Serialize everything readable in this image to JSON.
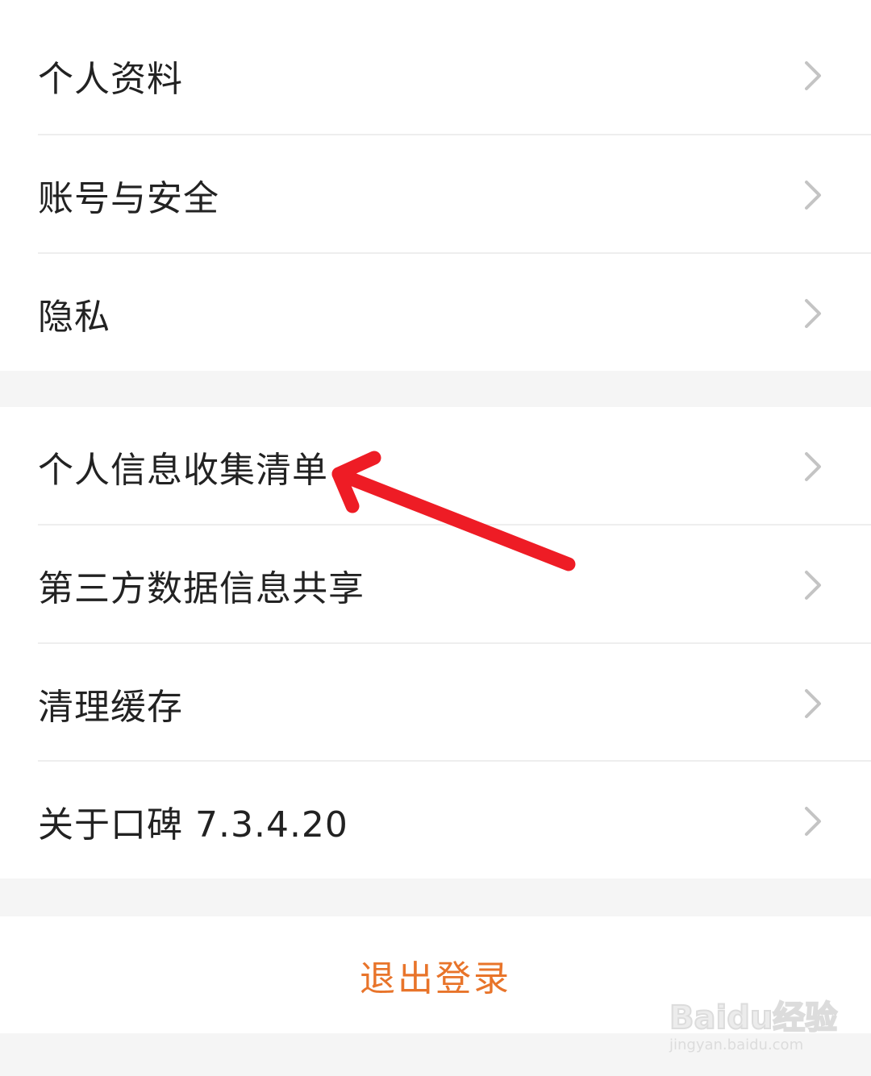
{
  "colors": {
    "page_background": "#f5f5f5",
    "card_background": "#ffffff",
    "text_primary": "#222222",
    "chevron": "#c4c4c4",
    "divider": "#eeeeee",
    "logout_text": "#e8742a",
    "annotation_arrow": "#ee1c25"
  },
  "settings_group_1": [
    {
      "label": "个人资料",
      "icon": "chevron-right-icon"
    },
    {
      "label": "账号与安全",
      "icon": "chevron-right-icon"
    },
    {
      "label": "隐私",
      "icon": "chevron-right-icon"
    }
  ],
  "settings_group_2": [
    {
      "label": "个人信息收集清单",
      "icon": "chevron-right-icon"
    },
    {
      "label": "第三方数据信息共享",
      "icon": "chevron-right-icon"
    },
    {
      "label": "清理缓存",
      "icon": "chevron-right-icon"
    },
    {
      "label": "关于口碑 7.3.4.20",
      "icon": "chevron-right-icon"
    }
  ],
  "logout": {
    "label": "退出登录"
  },
  "watermark": {
    "brand": "Baidu经验",
    "url": "jingyan.baidu.com"
  }
}
